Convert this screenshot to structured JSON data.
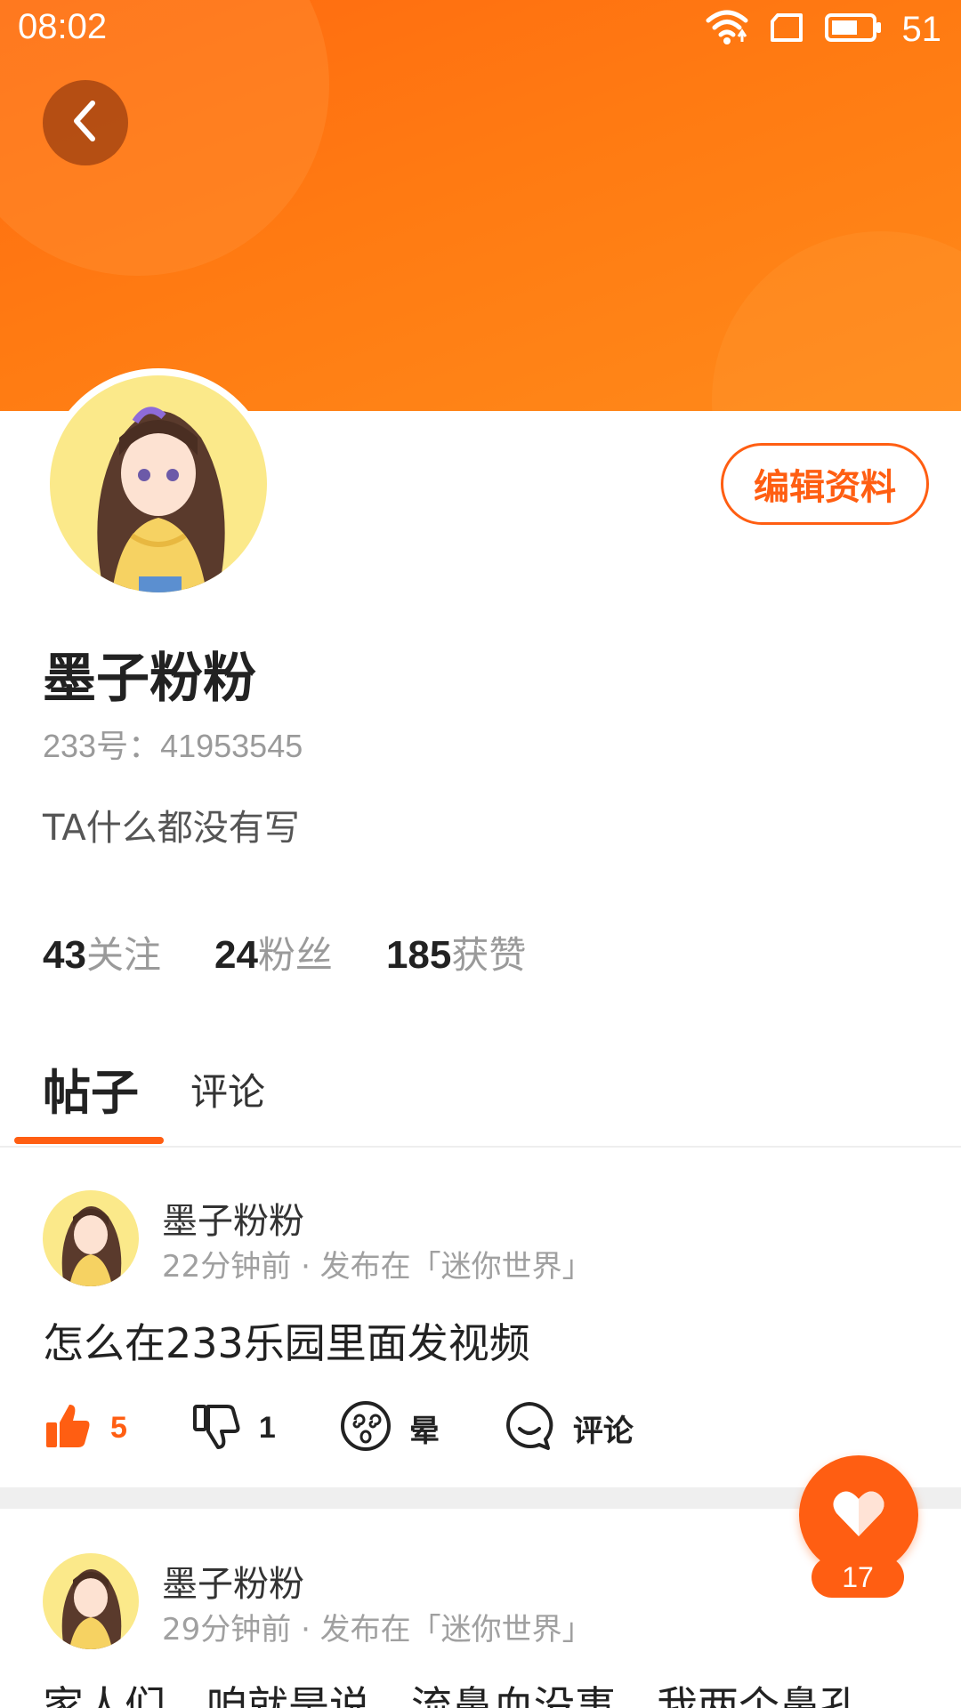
{
  "status_bar": {
    "time": "08:02",
    "battery": "51"
  },
  "profile": {
    "edit_button": "编辑资料",
    "name": "墨子粉粉",
    "uid": "233号：41953545",
    "bio": "TA什么都没有写",
    "stats": [
      {
        "value": "43",
        "label": "关注"
      },
      {
        "value": "24",
        "label": "粉丝"
      },
      {
        "value": "185",
        "label": "获赞"
      }
    ]
  },
  "tabs": [
    {
      "label": "帖子",
      "active": true
    },
    {
      "label": "评论",
      "active": false
    }
  ],
  "posts": [
    {
      "author": "墨子粉粉",
      "meta": "22分钟前 · 发布在「迷你世界」",
      "text": "怎么在233乐园里面发视频",
      "actions": {
        "like": "5",
        "dislike": "1",
        "dizzy": "晕",
        "comment": "评论"
      }
    },
    {
      "author": "墨子粉粉",
      "meta": "29分钟前 · 发布在「迷你世界」",
      "text": "家人们，咱就是说，流鼻血没事，我两个鼻孔"
    }
  ],
  "fab": {
    "count": "17"
  },
  "colors": {
    "accent": "#ff5e12",
    "banner": "#ff7a12"
  }
}
